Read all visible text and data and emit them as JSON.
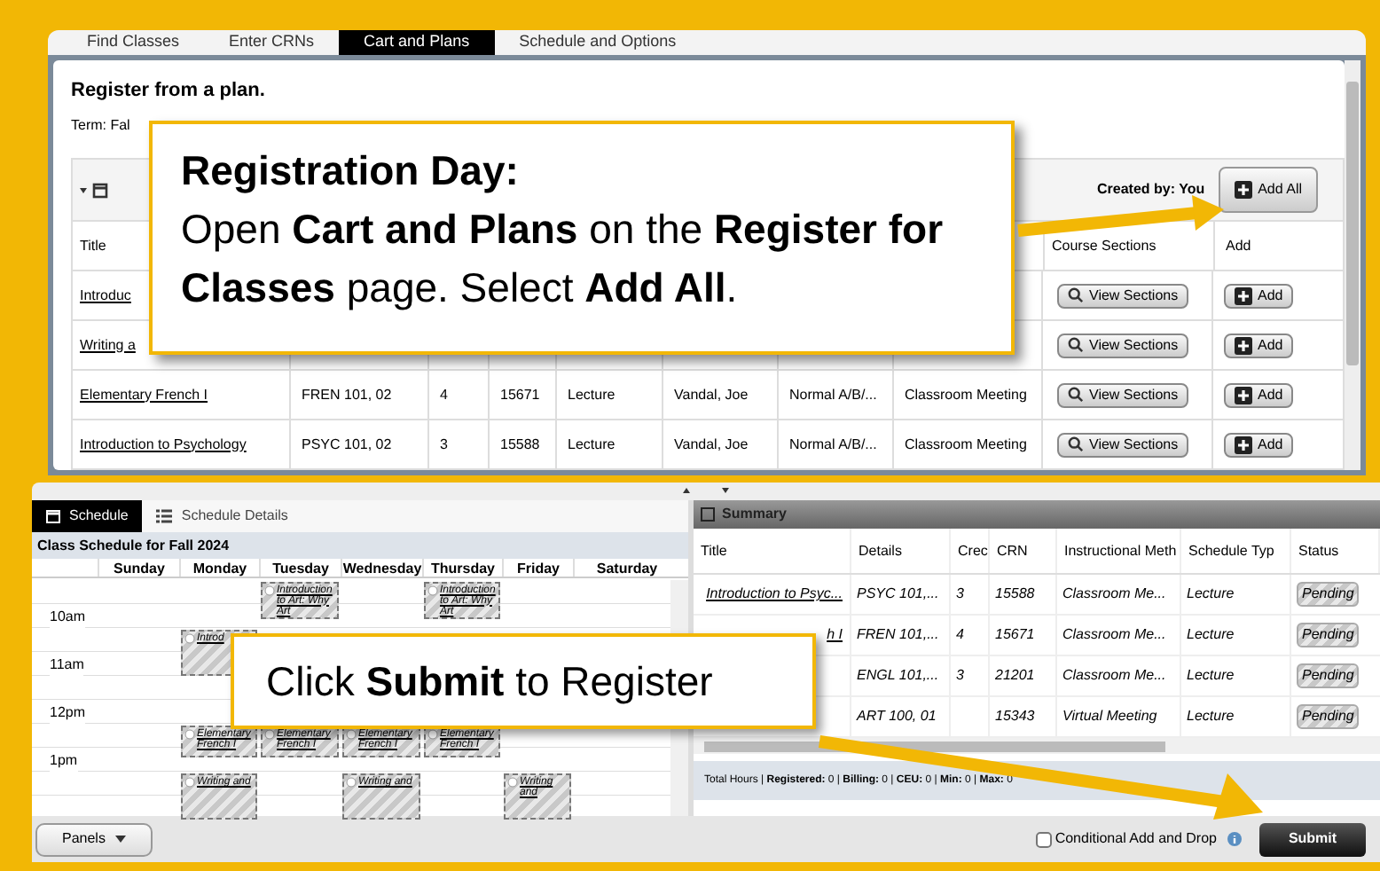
{
  "top_panel": {
    "tabs": [
      {
        "label": "Find Classes",
        "selected": false
      },
      {
        "label": "Enter CRNs",
        "selected": false
      },
      {
        "label": "Cart and Plans",
        "selected": true
      },
      {
        "label": "Schedule and Options",
        "selected": false
      }
    ],
    "heading": "Register from a plan.",
    "term": "Term: Fal",
    "created_by": "Created by: You",
    "add_all": "Add All",
    "columns": {
      "title": "Title",
      "sections": "Course Sections",
      "add": "Add"
    },
    "rows": [
      {
        "title": "Introduc",
        "view": "View Sections",
        "add": "Add"
      },
      {
        "title": "Writing a",
        "view": "View Sections",
        "add": "Add"
      },
      {
        "title": "Elementary French I",
        "details": "FREN 101, 02",
        "hours": "4",
        "crn": "15671",
        "schedule_type": "Lecture",
        "instructor": "Vandal, Joe",
        "grade_mode": "Normal A/B/...",
        "method": "Classroom Meeting",
        "view": "View Sections",
        "add": "Add"
      },
      {
        "title": "Introduction to Psychology",
        "details": "PSYC 101, 02",
        "hours": "3",
        "crn": "15588",
        "schedule_type": "Lecture",
        "instructor": "Vandal, Joe",
        "grade_mode": "Normal A/B/...",
        "method": "Classroom Meeting",
        "view": "View Sections",
        "add": "Add"
      }
    ]
  },
  "callouts": [
    {
      "title": "Registration Day:",
      "text": "Open **Cart and Plans** on the **Register for Classes** page. Select **Add All**."
    },
    {
      "text": "Click **Submit** to Register"
    }
  ],
  "schedule": {
    "tabs": [
      {
        "label": "Schedule",
        "selected": true
      },
      {
        "label": "Schedule Details",
        "selected": false
      }
    ],
    "title": "Class Schedule for Fall 2024",
    "times": [
      "10am",
      "11am",
      "12pm",
      "1pm"
    ],
    "days": [
      {
        "name": "Sunday"
      },
      {
        "name": "Monday",
        "events": [
          {
            "title": "Introd",
            "kind": "psych"
          },
          {
            "title": "Elementary French I",
            "kind": "french"
          },
          {
            "title": "Writing and",
            "kind": "writing"
          }
        ]
      },
      {
        "name": "Tuesday",
        "events": [
          {
            "title": "Introduction to Art: Why Art",
            "kind": "art"
          },
          {
            "title": "Elementary French I",
            "kind": "french"
          }
        ]
      },
      {
        "name": "Wednesday",
        "events": [
          {
            "title": "Elementary French I",
            "kind": "french"
          },
          {
            "title": "Writing and",
            "kind": "writing"
          }
        ]
      },
      {
        "name": "Thursday",
        "events": [
          {
            "title": "Introduction to Art: Why Art",
            "kind": "art"
          },
          {
            "title": "Elementary French I",
            "kind": "french"
          }
        ]
      },
      {
        "name": "Friday",
        "events": [
          {
            "title": "Writing and",
            "kind": "writing"
          }
        ]
      },
      {
        "name": "Saturday"
      }
    ]
  },
  "summary": {
    "title": "Summary",
    "columns": [
      "Title",
      "Details",
      "Crec",
      "CRN",
      "Instructional Meth",
      "Schedule Typ",
      "Status"
    ],
    "rows": [
      {
        "title": "Introduction to Psyc...",
        "details": "PSYC 101,...",
        "credits": "3",
        "crn": "15588",
        "method": "Classroom Me...",
        "type": "Lecture",
        "status": "Pending"
      },
      {
        "title": "h I",
        "details": "FREN 101,...",
        "credits": "4",
        "crn": "15671",
        "method": "Classroom Me...",
        "type": "Lecture",
        "status": "Pending"
      },
      {
        "details": "ENGL 101,...",
        "credits": "3",
        "crn": "21201",
        "method": "Classroom Me...",
        "type": "Lecture",
        "status": "Pending"
      },
      {
        "details": "ART 100, 01",
        "crn": "15343",
        "method": "Virtual Meeting",
        "type": "Lecture",
        "status": "Pending"
      }
    ],
    "totals": "Total Hours | **Registered:** 0 | **Billing:** 0 | **CEU:** 0 | **Min:** 0 | **Max:** 0"
  },
  "footer": {
    "panels": "Panels",
    "conditional": {
      "label": "Conditional Add and Drop",
      "checked": false
    },
    "submit": "Submit"
  }
}
